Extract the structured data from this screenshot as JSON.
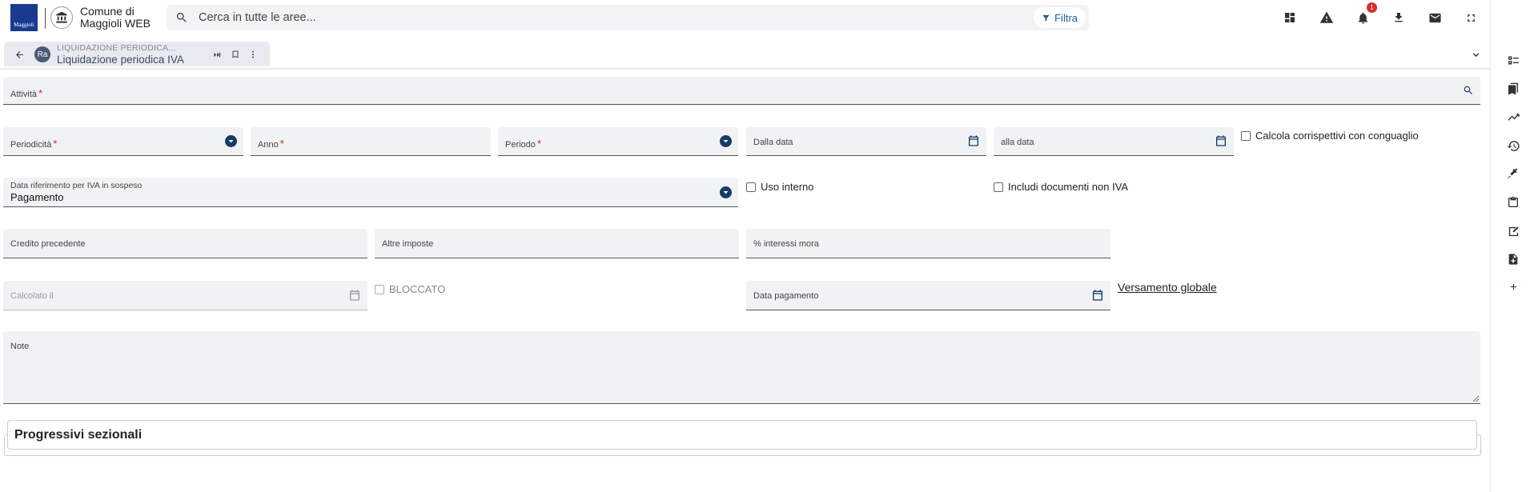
{
  "app": {
    "logo_text": "Maggioli",
    "brand_line1": "Comune di",
    "brand_line2": "Maggioli WEB"
  },
  "search": {
    "placeholder": "Cerca in tutte le aree...",
    "filter_label": "Filtra"
  },
  "topbar": {
    "icons": [
      "dashboard-icon",
      "warning-icon",
      "bell-icon",
      "download-icon",
      "mail-icon",
      "fullscreen-icon",
      "account-icon"
    ],
    "notification_count": "1"
  },
  "tab": {
    "subtitle": "LIQUIDAZIONE PERIODICA...",
    "title": "Liquidazione periodica IVA",
    "avatar": "Ra"
  },
  "form": {
    "attivita": {
      "label": "Attività",
      "required": true
    },
    "periodicita": {
      "label": "Periodicità",
      "required": true
    },
    "anno": {
      "label": "Anno",
      "required": true
    },
    "periodo": {
      "label": "Periodo",
      "required": true
    },
    "dalla_data": {
      "label": "Dalla data"
    },
    "alla_data": {
      "label": "alla data"
    },
    "calcola_corrispettivi": {
      "label": "Calcola corrispettivi con conguaglio",
      "checked": false
    },
    "data_riferimento": {
      "label": "Data riferimento per IVA in sospeso",
      "value": "Pagamento"
    },
    "uso_interno": {
      "label": "Uso interno",
      "checked": false
    },
    "includi_documenti": {
      "label": "Includi documenti non IVA",
      "checked": false
    },
    "credito_precedente": {
      "label": "Credito precedente"
    },
    "altre_imposte": {
      "label": "Altre imposte"
    },
    "interessi_mora": {
      "label": "% interessi mora"
    },
    "calcolato_il": {
      "label": "Calcolato il"
    },
    "bloccato": {
      "label": "BLOCCATO",
      "checked": false
    },
    "data_pagamento": {
      "label": "Data pagamento"
    },
    "versamento_globale": {
      "label": "Versamento globale"
    },
    "note": {
      "label": "Note"
    }
  },
  "section": {
    "title": "Progressivi sezionali"
  },
  "rail": {
    "icons": [
      "checklist-icon",
      "bookmarks-icon",
      "trending-icon",
      "history-icon",
      "plugin-icon",
      "clipboard-icon",
      "signature-icon",
      "document-add-icon",
      "add-icon"
    ]
  },
  "colors": {
    "accent": "#163b66",
    "field_bg": "#f1f2f4",
    "required": "#c62828",
    "badge": "#d32f2f"
  }
}
